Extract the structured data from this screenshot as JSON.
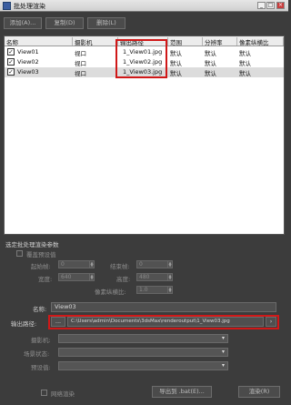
{
  "window": {
    "title": "批处理渲染",
    "minimize": "_",
    "maximize": "□",
    "close": "×"
  },
  "toolbar": {
    "add_label": "添加(A)...",
    "copy_label": "复制(D)",
    "delete_label": "删除(L)"
  },
  "table": {
    "columns": [
      "名称",
      "摄影机",
      "输出路径",
      "范围",
      "分辨率",
      "像素纵横比"
    ],
    "rows": [
      {
        "checked": true,
        "name": "View01",
        "camera": "视口",
        "output": "1_View01.jpg",
        "range": "默认",
        "resolution": "默认",
        "aspect": "默认"
      },
      {
        "checked": true,
        "name": "View02",
        "camera": "视口",
        "output": "1_View02.jpg",
        "range": "默认",
        "resolution": "默认",
        "aspect": "默认"
      },
      {
        "checked": true,
        "name": "View03",
        "camera": "视口",
        "output": "1_View03.jpg",
        "range": "默认",
        "resolution": "默认",
        "aspect": "默认"
      }
    ]
  },
  "params": {
    "section_title": "选定批处理渲染参数",
    "override_preset": "覆盖预设值",
    "start_frame_label": "起始帧:",
    "start_frame_value": "0",
    "end_frame_label": "结束帧:",
    "end_frame_value": "0",
    "width_label": "宽度:",
    "width_value": "640",
    "height_label": "高度:",
    "height_value": "480",
    "aspect_label": "像素纵横比:",
    "aspect_value": "1.0",
    "name_label": "名称:",
    "name_value": "View03",
    "output_label": "输出路径:",
    "browse_label": "...",
    "output_path": "C:\\Users\\admin\\Documents\\3dsMax\\renderoutput\\1_View03.jpg",
    "clear_arrow": "›",
    "camera_label": "摄影机:",
    "scene_state_label": "场景状态:",
    "preset_label": "预设值:"
  },
  "footer": {
    "net_render": "网络渲染",
    "export_label": "导出到 .bat(E)...",
    "render_label": "渲染(R)"
  },
  "colors": {
    "highlight": "#d01818"
  }
}
